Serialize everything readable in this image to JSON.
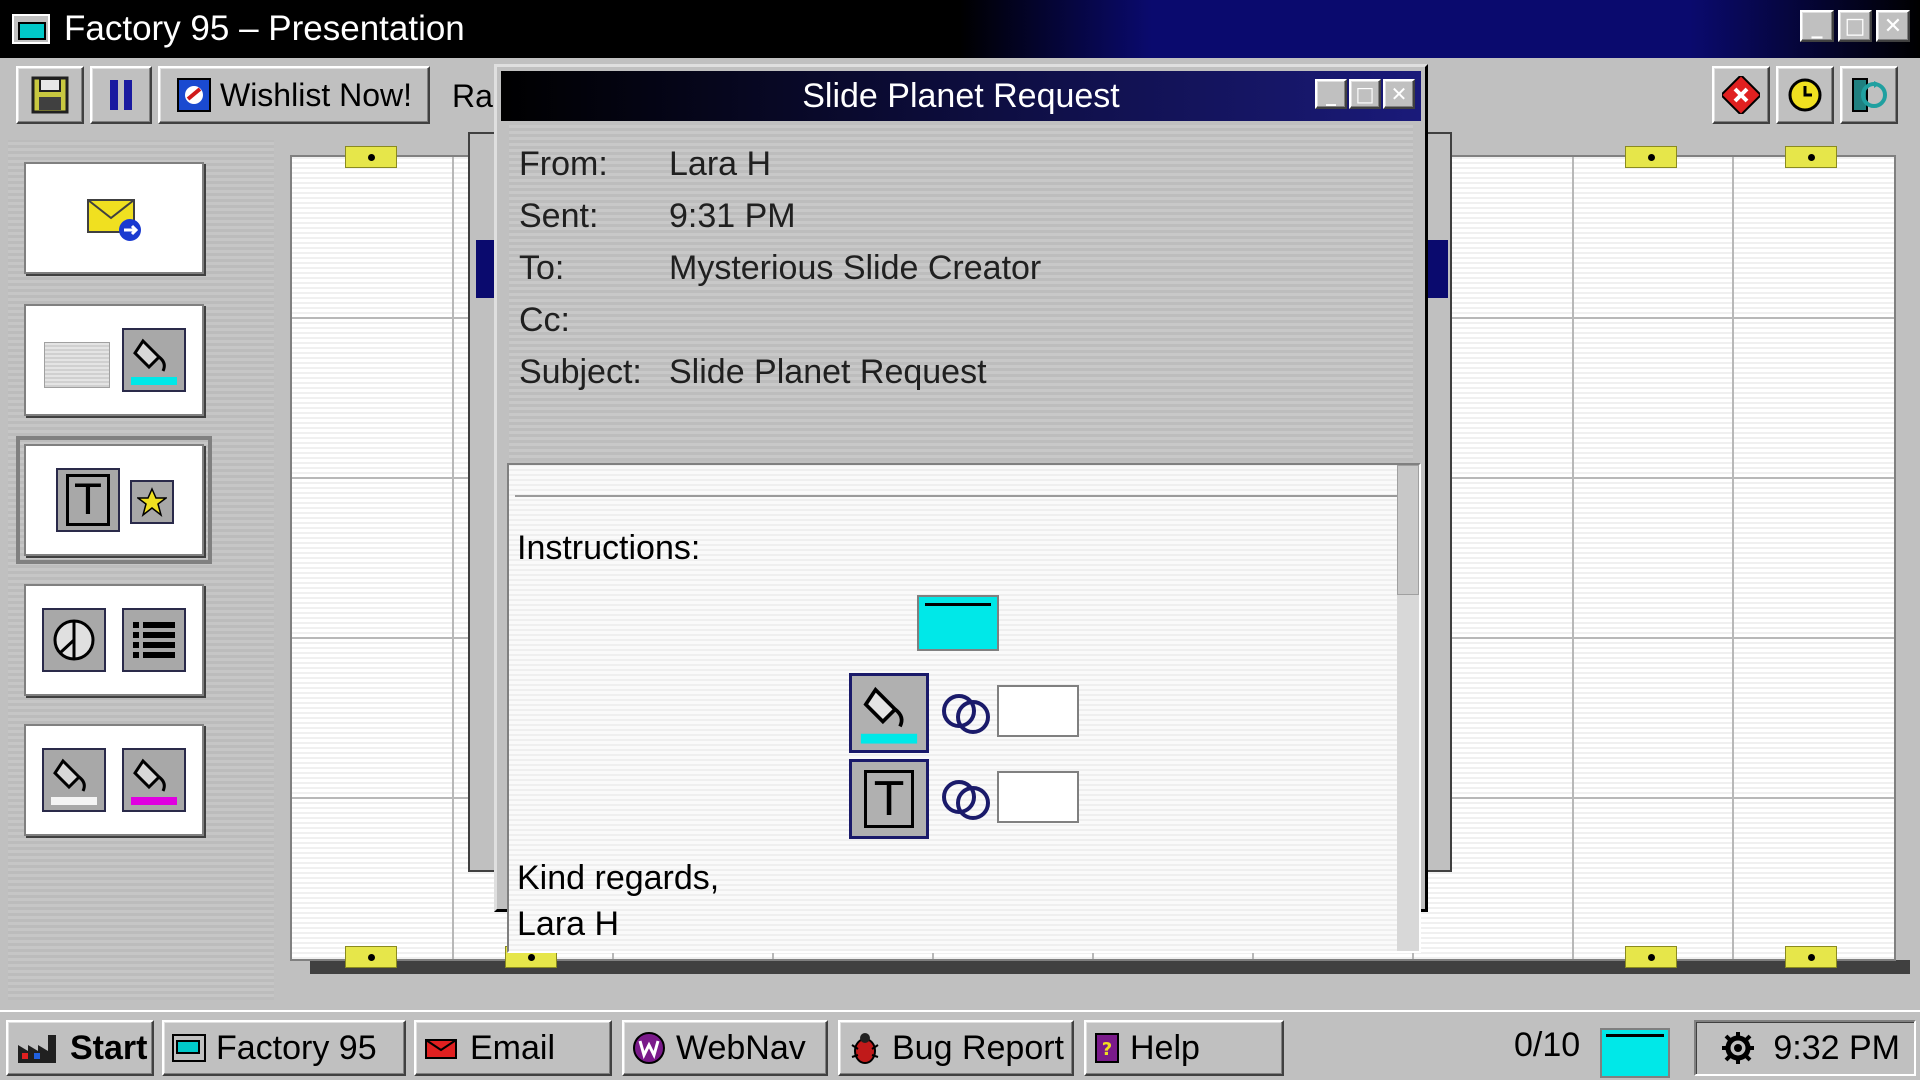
{
  "window": {
    "title": "Factory 95 – Presentation"
  },
  "toolbar": {
    "wishlist_label": "Wishlist Now!",
    "cut_off_label": "Ra"
  },
  "dialog": {
    "title": "Slide Planet Request",
    "headers": [
      {
        "label": "From:",
        "value": "Lara H"
      },
      {
        "label": "Sent:",
        "value": "9:31 PM"
      },
      {
        "label": "To:",
        "value": "Mysterious Slide Creator"
      },
      {
        "label": "Cc:",
        "value": ""
      },
      {
        "label": "Subject:",
        "value": "Slide Planet Request"
      }
    ],
    "body": {
      "instructions_label": "Instructions:",
      "closing": "Kind regards,",
      "signature": "Lara H"
    }
  },
  "taskbar": {
    "start": "Start",
    "tasks": [
      {
        "label": "Factory 95",
        "icon": "factory-icon"
      },
      {
        "label": "Email",
        "icon": "email-icon"
      },
      {
        "label": "WebNav",
        "icon": "webnav-icon"
      },
      {
        "label": "Bug Report",
        "icon": "bug-icon"
      },
      {
        "label": "Help",
        "icon": "help-icon"
      }
    ],
    "progress": "0/10",
    "clock": "9:32 PM"
  },
  "colors": {
    "accent_cyan": "#00e8e8",
    "title_navy": "#0a0a6e",
    "pin_yellow": "#e6e64a",
    "magenta": "#e000e0"
  }
}
